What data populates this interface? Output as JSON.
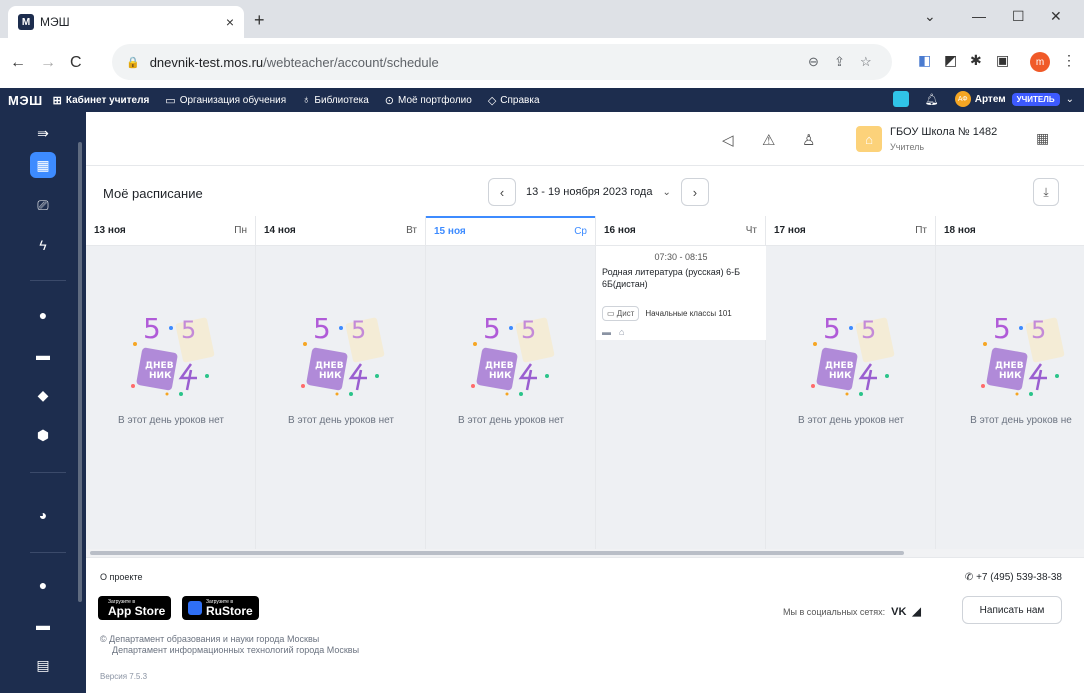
{
  "browser": {
    "tab_title": "МЭШ",
    "favicon": "М",
    "close_tab": "×",
    "new_tab": "+",
    "url_host": "dnevnik-test.mos.ru",
    "url_path": "/webteacher/account/schedule",
    "profile_initial": "m"
  },
  "appbar": {
    "logo": "МЭШ",
    "nav": [
      {
        "label": "Кабинет учителя",
        "icon": "grid-icon"
      },
      {
        "label": "Организация обучения",
        "icon": "monitor-icon"
      },
      {
        "label": "Библиотека",
        "icon": "bulb-icon"
      },
      {
        "label": "Моё портфолио",
        "icon": "check-circle-icon"
      },
      {
        "label": "Справка",
        "icon": "help-icon"
      }
    ],
    "user_initials": "АФ",
    "user_name": "Артем",
    "user_role": "УЧИТЕЛЬ"
  },
  "header": {
    "school_name": "ГБОУ Школа № 1482",
    "school_role": "Учитель"
  },
  "toolbar": {
    "title": "Моё расписание",
    "week_label": "13 - 19 ноября 2023 года"
  },
  "days": [
    {
      "date": "13 ноя",
      "weekday": "Пн",
      "empty_text": "В этот день уроков нет"
    },
    {
      "date": "14 ноя",
      "weekday": "Вт",
      "empty_text": "В этот день уроков нет"
    },
    {
      "date": "15 ноя",
      "weekday": "Ср",
      "empty_text": "В этот день уроков нет"
    },
    {
      "date": "16 ноя",
      "weekday": "Чт",
      "empty_text": ""
    },
    {
      "date": "17 ноя",
      "weekday": "Пт",
      "empty_text": "В этот день уроков нет"
    },
    {
      "date": "18 ноя",
      "weekday": "",
      "empty_text": "В этот день уроков не"
    }
  ],
  "lesson": {
    "time": "07:30 - 08:15",
    "subject": "Родная литература (русская) 6-Б 6Б(дистан)",
    "format": "Дист",
    "room": "Начальные классы 101"
  },
  "illustration": {
    "badge_line1": "ДНЕВ",
    "badge_line2": "НИК"
  },
  "footer": {
    "about": "О проекте",
    "appstore_small": "Загрузите в",
    "appstore_big": "App Store",
    "rustore_small": "Загрузите в",
    "rustore_big": "RuStore",
    "copyright_line1": "Департамент образования и науки города Москвы",
    "copyright_line2": "Департамент информационных технологий города Москвы",
    "version": "Версия 7.5.3",
    "phone": "+7 (495) 539-38-38",
    "social_label": "Мы в социальных сетях:",
    "write_us": "Написать нам"
  }
}
